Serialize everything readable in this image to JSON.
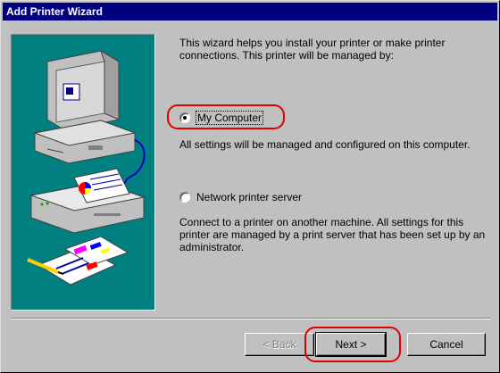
{
  "window": {
    "title": "Add Printer Wizard"
  },
  "intro": "This wizard helps you install your printer or make printer connections.  This printer will be managed by:",
  "options": [
    {
      "label": "My Computer",
      "selected": true,
      "description": "All settings will be managed and configured on this computer."
    },
    {
      "label": "Network printer server",
      "selected": false,
      "description": "Connect to a printer on another machine.  All settings for this printer are managed by a print server that has been set up by an administrator."
    }
  ],
  "buttons": {
    "back": "< Back",
    "next": "Next >",
    "cancel": "Cancel"
  },
  "colors": {
    "titlebar": "#000080",
    "face": "#c0c0c0",
    "art_background": "#008080",
    "highlight": "#e00000"
  }
}
